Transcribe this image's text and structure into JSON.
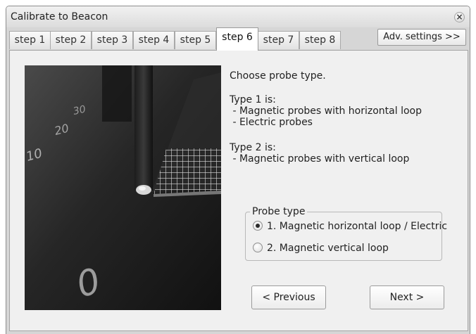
{
  "window": {
    "title": "Calibrate to Beacon",
    "close_glyph": "×"
  },
  "tabs": [
    {
      "label": "step 1",
      "active": false
    },
    {
      "label": "step 2",
      "active": false
    },
    {
      "label": "step 3",
      "active": false
    },
    {
      "label": "step 4",
      "active": false
    },
    {
      "label": "step 5",
      "active": false
    },
    {
      "label": "step 6",
      "active": true
    },
    {
      "label": "step 7",
      "active": false
    },
    {
      "label": "step 8",
      "active": false
    }
  ],
  "adv_settings": {
    "label": "Adv. settings >>"
  },
  "content": {
    "instruction": "Choose probe type.",
    "type1_text": "Type 1 is:\n - Magnetic probes with horizontal loop\n - Electric probes",
    "type2_text": "Type 2 is:\n - Magnetic probes with vertical loop"
  },
  "probe_type": {
    "title": "Probe type",
    "options": [
      {
        "label": "1. Magnetic horizontal loop / Electric",
        "checked": true
      },
      {
        "label": "2. Magnetic vertical loop",
        "checked": false
      }
    ]
  },
  "buttons": {
    "previous": "< Previous",
    "next": "Next >"
  },
  "photo": {
    "scale_labels": [
      "30",
      "20",
      "10",
      "0"
    ]
  }
}
